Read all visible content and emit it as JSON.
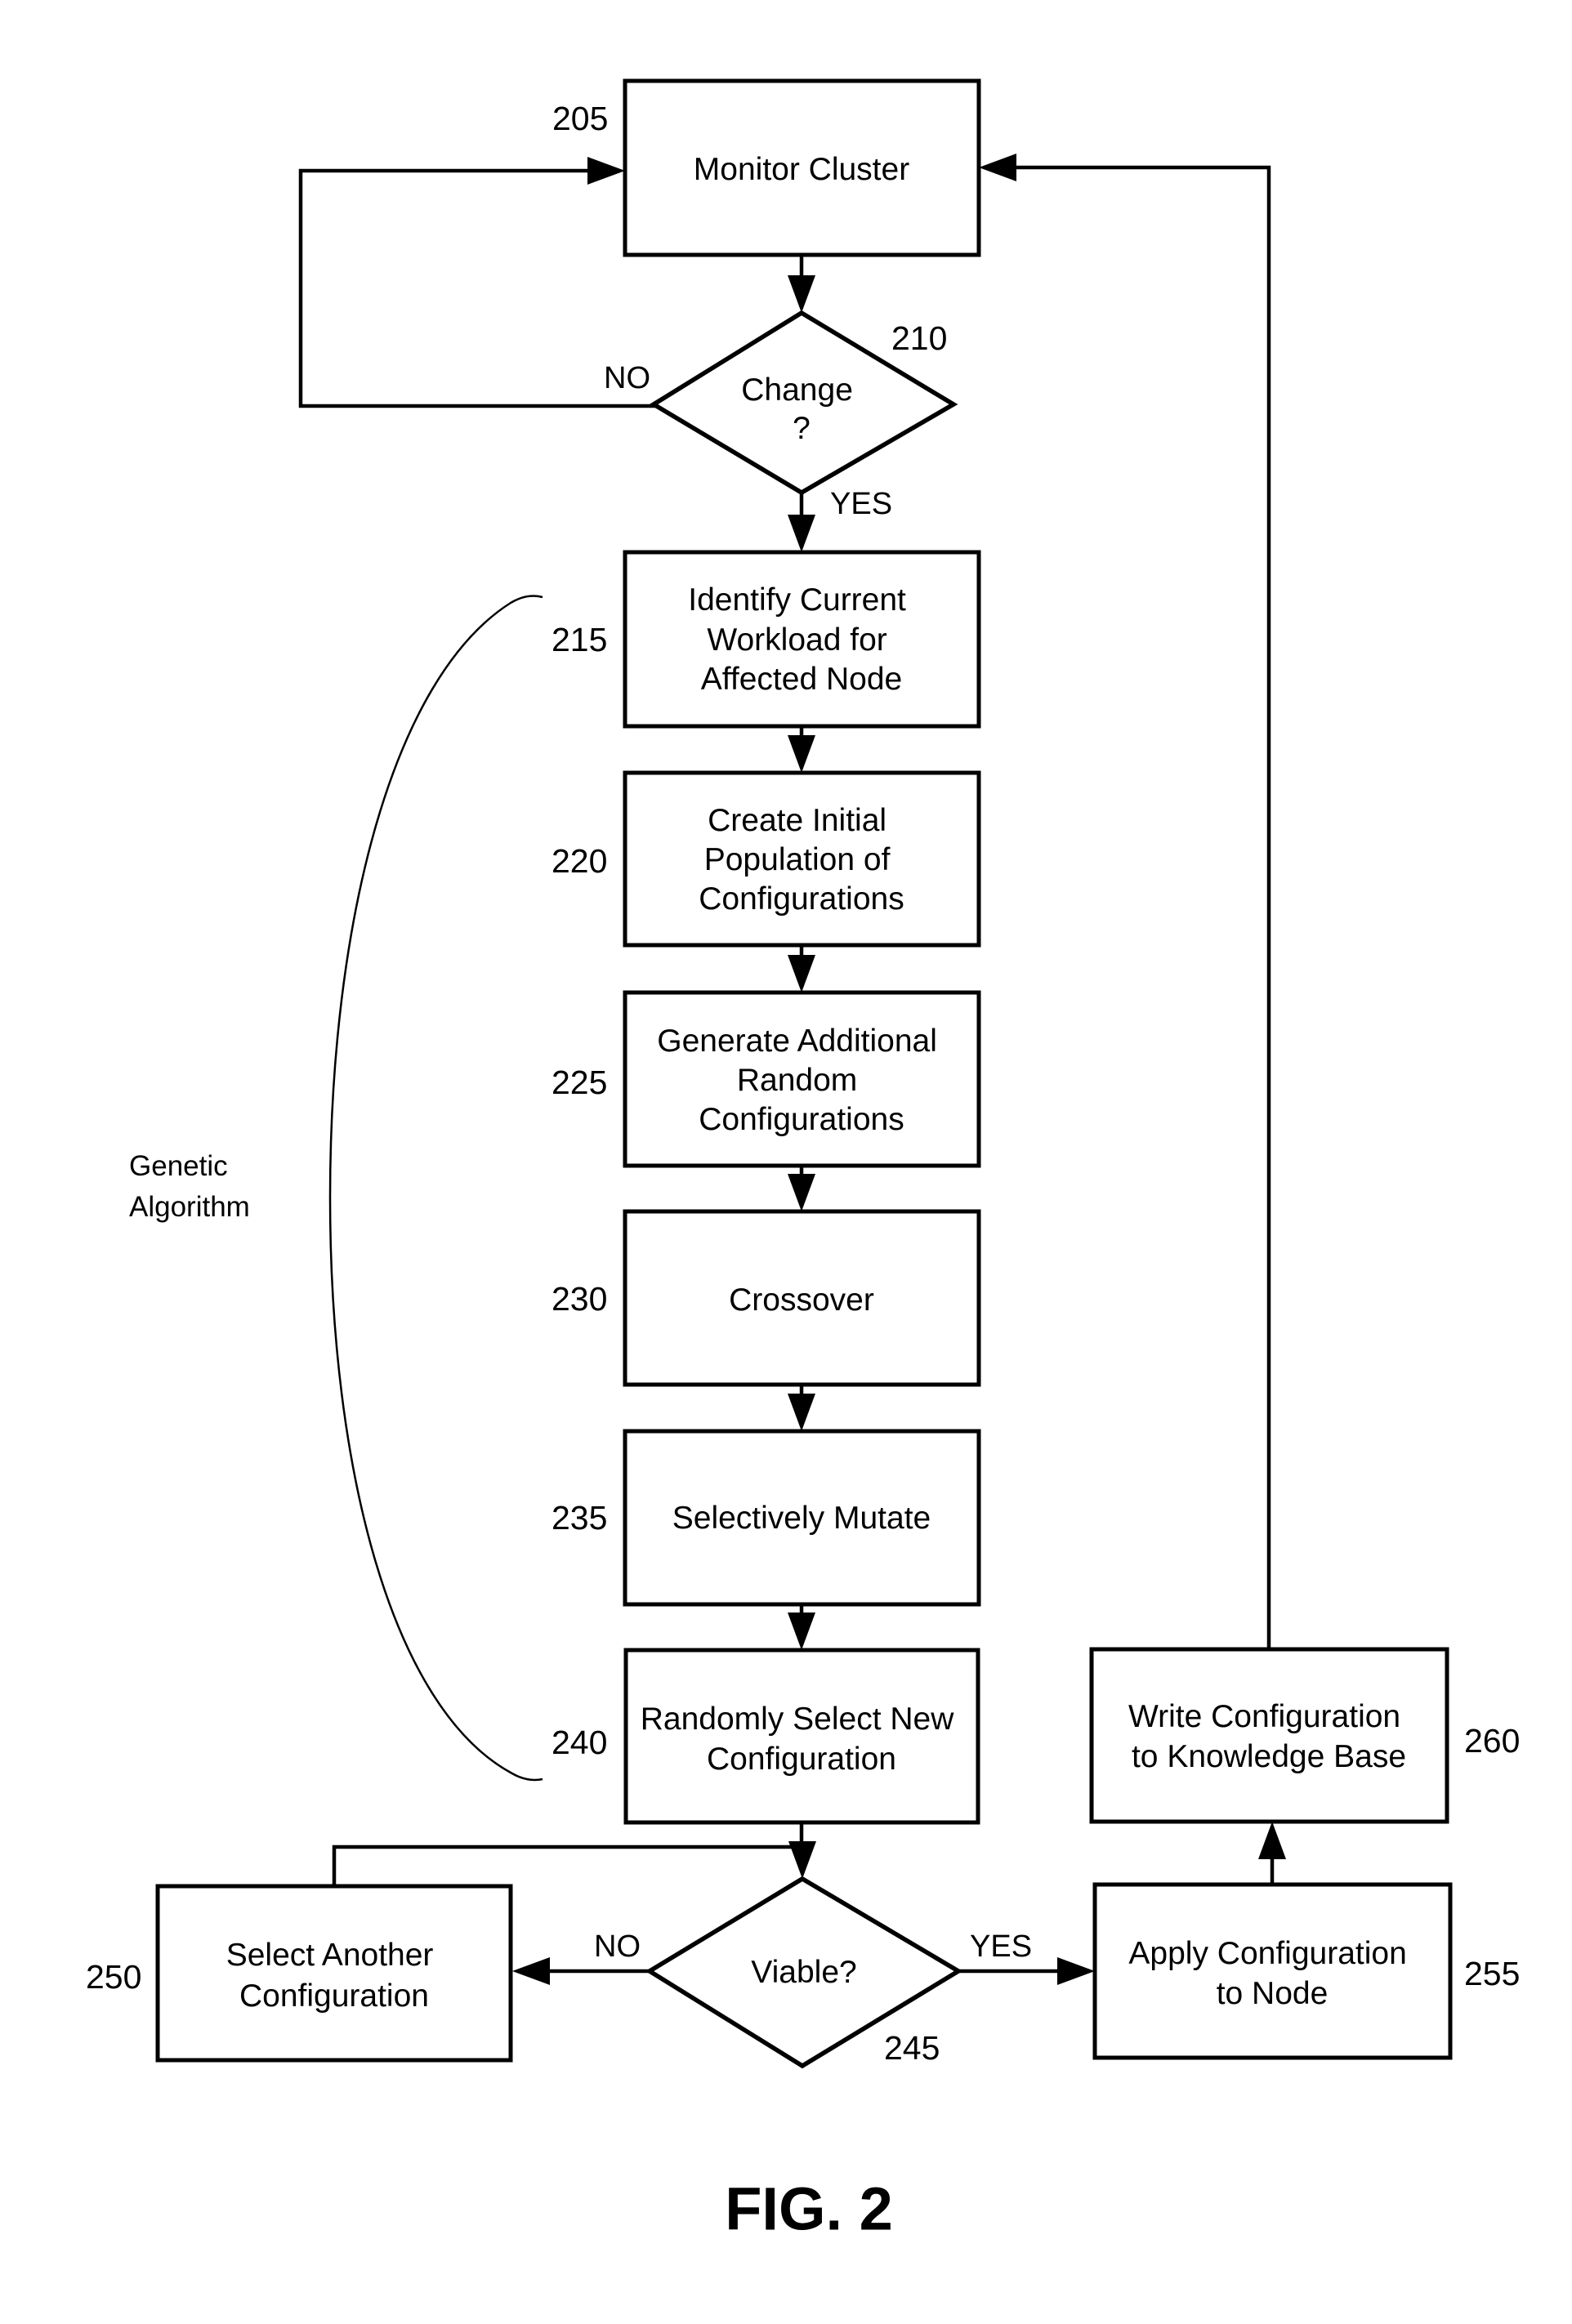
{
  "figure": {
    "caption": "FIG. 2",
    "side_label": [
      "Genetic",
      "Algorithm"
    ]
  },
  "steps": [
    {
      "ref": "205",
      "lines": [
        "Monitor Cluster"
      ]
    },
    {
      "ref": "215",
      "lines": [
        "Identify Current",
        "Workload for",
        "Affected Node"
      ]
    },
    {
      "ref": "220",
      "lines": [
        "Create Initial",
        "Population of",
        "Configurations"
      ]
    },
    {
      "ref": "225",
      "lines": [
        "Generate Additional",
        "Random",
        "Configurations"
      ]
    },
    {
      "ref": "230",
      "lines": [
        "Crossover"
      ]
    },
    {
      "ref": "235",
      "lines": [
        "Selectively Mutate"
      ]
    },
    {
      "ref": "240",
      "lines": [
        "Randomly Select New",
        "Configuration"
      ]
    },
    {
      "ref": "250",
      "lines": [
        "Select Another",
        "Configuration"
      ]
    },
    {
      "ref": "255",
      "lines": [
        "Apply Configuration",
        "to Node"
      ]
    },
    {
      "ref": "260",
      "lines": [
        "Write Configuration",
        "to Knowledge Base"
      ]
    }
  ],
  "decisions": [
    {
      "ref": "210",
      "lines": [
        "Change",
        "?"
      ],
      "no_label": "NO",
      "yes_label": "YES"
    },
    {
      "ref": "245",
      "lines": [
        "Viable?"
      ],
      "no_label": "NO",
      "yes_label": "YES"
    }
  ]
}
